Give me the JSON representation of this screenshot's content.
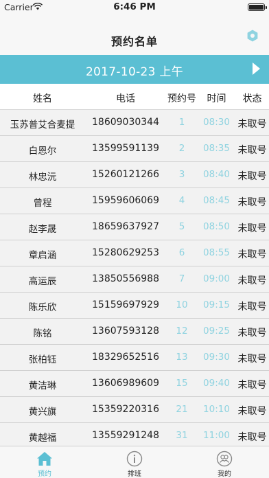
{
  "status_bar": {
    "carrier": "Carrier",
    "time": "6:46 PM"
  },
  "nav": {
    "title": "预约名单",
    "settings_icon": "gear-icon"
  },
  "date_bar": {
    "date": "2017-10-23 上午",
    "next_icon": "play-right-icon"
  },
  "table": {
    "headers": [
      "姓名",
      "电话",
      "预约号",
      "时间",
      "状态"
    ],
    "rows": [
      {
        "name": "玉苏普艾合麦提",
        "phone": "18609030344",
        "num": "1",
        "time": "08:30",
        "status": "未取号"
      },
      {
        "name": "白恩尔",
        "phone": "13599591139",
        "num": "2",
        "time": "08:35",
        "status": "未取号"
      },
      {
        "name": "林忠沅",
        "phone": "15260121266",
        "num": "3",
        "time": "08:40",
        "status": "未取号"
      },
      {
        "name": "曾程",
        "phone": "15959606069",
        "num": "4",
        "time": "08:45",
        "status": "未取号"
      },
      {
        "name": "赵李晟",
        "phone": "18659637927",
        "num": "5",
        "time": "08:50",
        "status": "未取号"
      },
      {
        "name": "章启涵",
        "phone": "15280629253",
        "num": "6",
        "time": "08:55",
        "status": "未取号"
      },
      {
        "name": "高运辰",
        "phone": "13850556988",
        "num": "7",
        "time": "09:00",
        "status": "未取号"
      },
      {
        "name": "陈乐欣",
        "phone": "15159697929",
        "num": "10",
        "time": "09:15",
        "status": "未取号"
      },
      {
        "name": "陈铭",
        "phone": "13607593128",
        "num": "12",
        "time": "09:25",
        "status": "未取号"
      },
      {
        "name": "张柏钰",
        "phone": "18329652516",
        "num": "13",
        "time": "09:30",
        "status": "未取号"
      },
      {
        "name": "黄洁琳",
        "phone": "13606989609",
        "num": "15",
        "time": "09:40",
        "status": "未取号"
      },
      {
        "name": "黄兴旗",
        "phone": "15359220316",
        "num": "21",
        "time": "10:10",
        "status": "未取号"
      },
      {
        "name": "黄越福",
        "phone": "13559291248",
        "num": "31",
        "time": "11:00",
        "status": "未取号"
      }
    ]
  },
  "tabs": [
    {
      "label": "预约",
      "icon": "home-icon",
      "active": true
    },
    {
      "label": "排班",
      "icon": "info-icon",
      "active": false
    },
    {
      "label": "我的",
      "icon": "users-icon",
      "active": false
    }
  ],
  "colors": {
    "accent": "#5bbfd3",
    "accent_light": "#8fd3e0",
    "row_bg": "#f2f2f2"
  }
}
